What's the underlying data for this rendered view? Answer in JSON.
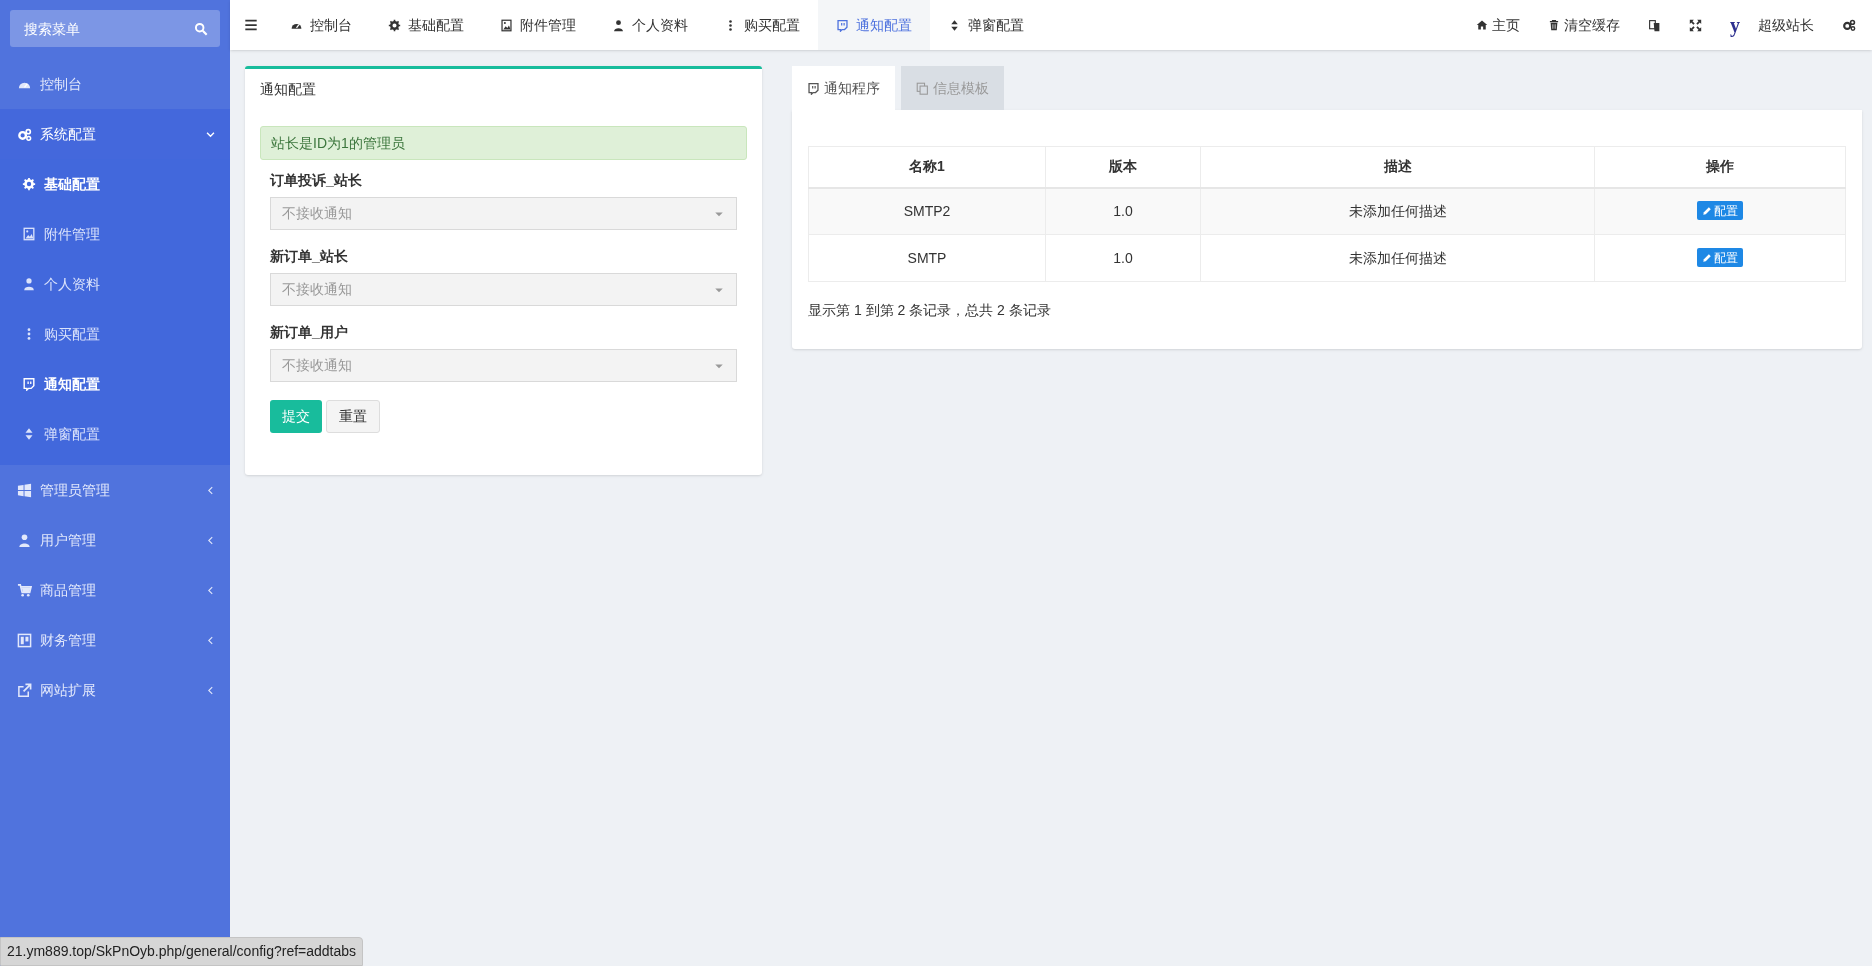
{
  "sidebar": {
    "search": {
      "placeholder": "搜索菜单"
    },
    "items": [
      {
        "label": "控制台",
        "selected": false
      },
      {
        "label": "系统配置",
        "selected": false,
        "expanded": true,
        "children": [
          {
            "label": "基础配置",
            "selected": true
          },
          {
            "label": "附件管理",
            "selected": false
          },
          {
            "label": "个人资料",
            "selected": false
          },
          {
            "label": "购买配置",
            "selected": false
          },
          {
            "label": "通知配置",
            "selected": true
          },
          {
            "label": "弹窗配置",
            "selected": false
          }
        ]
      },
      {
        "label": "管理员管理",
        "selected": false,
        "expanded": false
      },
      {
        "label": "用户管理",
        "selected": false,
        "expanded": false
      },
      {
        "label": "商品管理",
        "selected": false,
        "expanded": false
      },
      {
        "label": "财务管理",
        "selected": false,
        "expanded": false
      },
      {
        "label": "网站扩展",
        "selected": false,
        "expanded": false
      }
    ]
  },
  "top_tabs": [
    {
      "label": "控制台",
      "selected": false
    },
    {
      "label": "基础配置",
      "selected": false
    },
    {
      "label": "附件管理",
      "selected": false
    },
    {
      "label": "个人资料",
      "selected": false
    },
    {
      "label": "购买配置",
      "selected": false
    },
    {
      "label": "通知配置",
      "selected": true
    },
    {
      "label": "弹窗配置",
      "selected": false
    }
  ],
  "top_right": {
    "home": "主页",
    "clear_cache": "清空缓存",
    "avatar_letter": "y",
    "user_name": "超级站长"
  },
  "form_panel": {
    "title": "通知配置",
    "alert": "站长是ID为1的管理员",
    "fields": [
      {
        "label": "订单投诉_站长",
        "placeholder": "不接收通知"
      },
      {
        "label": "新订单_站长",
        "placeholder": "不接收通知"
      },
      {
        "label": "新订单_用户",
        "placeholder": "不接收通知"
      }
    ],
    "buttons": [
      "提交",
      "重置"
    ]
  },
  "notify_panel": {
    "tabs": [
      {
        "label": "通知程序",
        "selected": true
      },
      {
        "label": "信息模板",
        "selected": false
      }
    ],
    "table": {
      "columns": [
        "名称1",
        "版本",
        "描述",
        "操作"
      ],
      "rows": [
        {
          "name": "SMTP2",
          "version": "1.0",
          "description": "未添加任何描述",
          "action": "配置"
        },
        {
          "name": "SMTP",
          "version": "1.0",
          "description": "未添加任何描述",
          "action": "配置"
        }
      ]
    },
    "footer": "显示第 1 到第 2 条记录，总共 2 条记录"
  },
  "status_bar": "21.ym889.top/SkPnOyb.php/general/config?ref=addtabs"
}
